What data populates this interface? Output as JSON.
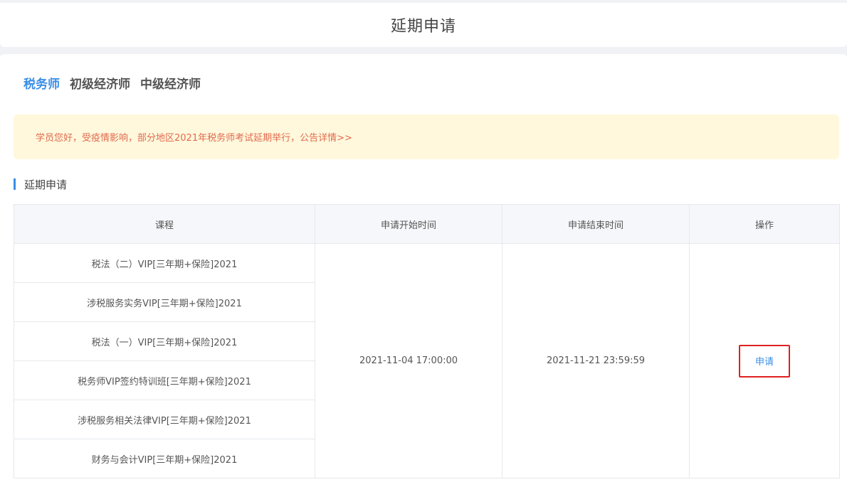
{
  "header": {
    "title": "延期申请"
  },
  "tabs": [
    {
      "label": "税务师",
      "active": true
    },
    {
      "label": "初级经济师",
      "active": false
    },
    {
      "label": "中级经济师",
      "active": false
    }
  ],
  "notice": {
    "text": "学员您好，受疫情影响，部分地区2021年税务师考试延期举行，公告详情>>"
  },
  "section": {
    "title": "延期申请"
  },
  "table": {
    "columns": [
      "课程",
      "申请开始时间",
      "申请结束时间",
      "操作"
    ],
    "courses": [
      "税法（二）VIP[三年期+保险]2021",
      "涉税服务实务VIP[三年期+保险]2021",
      "税法（一）VIP[三年期+保险]2021",
      "税务师VIP签约特训班[三年期+保险]2021",
      "涉税服务相关法律VIP[三年期+保险]2021",
      "财务与会计VIP[三年期+保险]2021"
    ],
    "start_time": "2021-11-04 17:00:00",
    "end_time": "2021-11-21 23:59:59",
    "action_label": "申请"
  },
  "colors": {
    "accent": "#3a8ee6",
    "notice_bg": "#fff8dc",
    "notice_text": "#e06a4e",
    "highlight_border": "#e02020"
  }
}
